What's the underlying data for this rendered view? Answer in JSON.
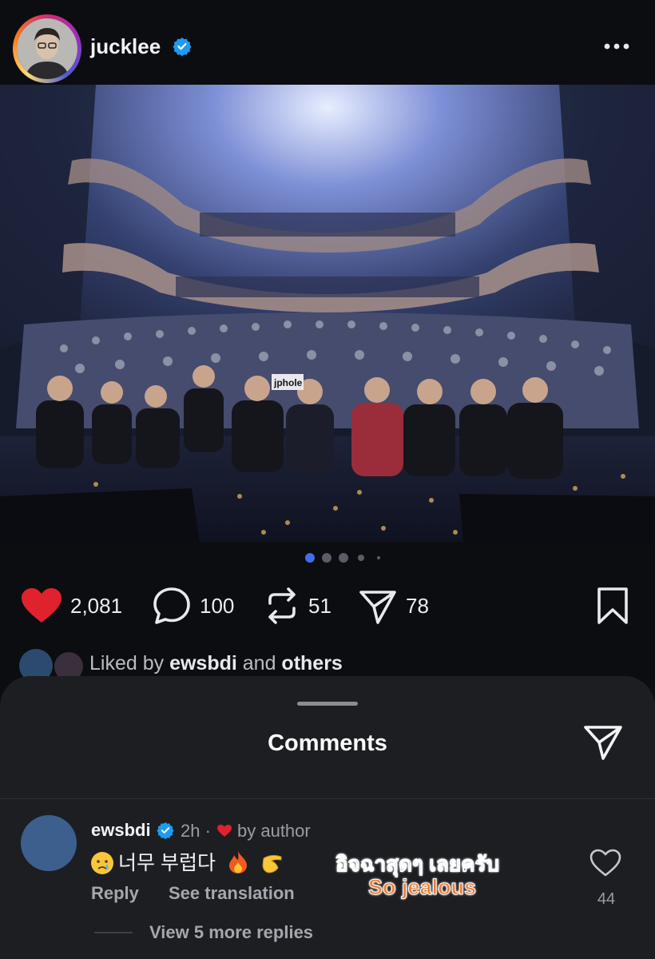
{
  "post": {
    "username": "jucklee",
    "verified": true,
    "more_icon": "more-horizontal-icon",
    "photo_label": "jphole",
    "carousel": {
      "count": 5,
      "active_index": 0
    }
  },
  "actions": {
    "likes": "2,081",
    "comments": "100",
    "reposts": "51",
    "shares": "78",
    "liked": true,
    "like_color": "#e0222e"
  },
  "liked_by": {
    "prefix": "Liked by ",
    "user": "ewsbdi",
    "middle": " and ",
    "others": "others"
  },
  "comments_sheet": {
    "title": "Comments",
    "send_icon": "send-icon",
    "comment": {
      "username": "ewsbdi",
      "verified": true,
      "time": "2h ·",
      "liked_by_author": "by author",
      "text": "너무 부럽다",
      "reply": "Reply",
      "see_translation": "See translation",
      "like_count": "44",
      "view_replies": "View 5 more replies"
    }
  },
  "overlay_caption": {
    "line1": "อิจฉาสุดๆ เลยครับ",
    "line2": "So jealous"
  }
}
